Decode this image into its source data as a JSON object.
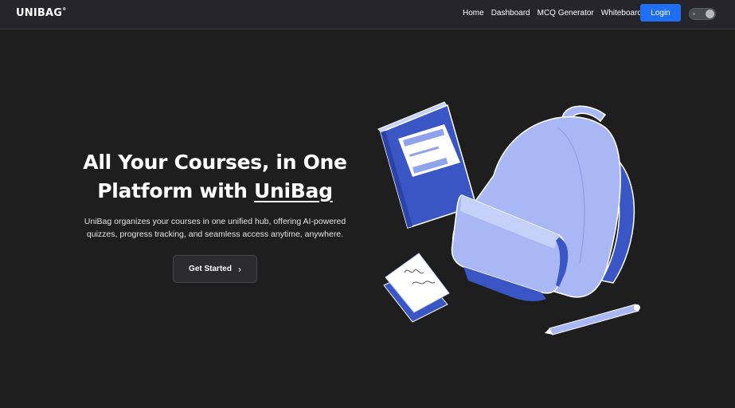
{
  "header": {
    "logo": "UNIBAG",
    "logo_mark": "®",
    "nav": [
      {
        "label": "Home"
      },
      {
        "label": "Dashboard"
      },
      {
        "label": "MCQ Generator"
      },
      {
        "label": "Whiteboard"
      }
    ],
    "login_label": "Login",
    "theme_toggle": {
      "state": "on",
      "icon": "theme-toggle-icon"
    }
  },
  "hero": {
    "title_part1": "All Your Courses, in One Platform with ",
    "title_brand": "UniBag",
    "description": "UniBag organizes your courses in one unified hub, offering AI-powered quizzes, progress tracking, and seamless access anytime, anywhere.",
    "cta_label": "Get Started",
    "cta_icon": "chevron-right-icon"
  },
  "illustration": {
    "name": "backpack-book-notes-pencil-illustration"
  },
  "colors": {
    "background": "#1f1e1f",
    "navbar": "#25252b",
    "accent": "#1f6ff5",
    "illustration_dark_blue": "#3a56c4",
    "illustration_light_blue": "#a9b8f5"
  }
}
